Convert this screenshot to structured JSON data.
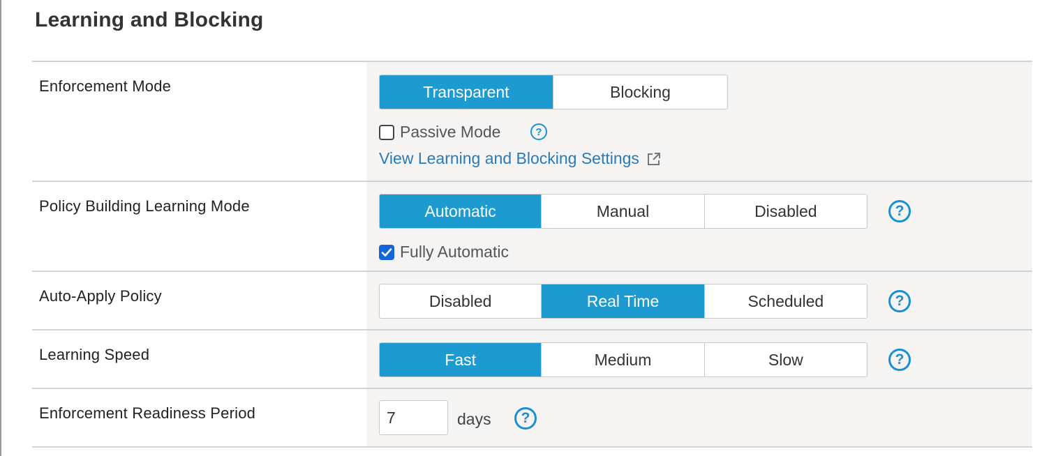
{
  "section": {
    "title": "Learning and Blocking"
  },
  "rows": {
    "enforcement_mode": {
      "label": "Enforcement Mode",
      "options": [
        "Transparent",
        "Blocking"
      ],
      "selected": "Transparent",
      "passive_mode_label": "Passive Mode",
      "passive_mode_checked": false,
      "settings_link": "View Learning and Blocking Settings"
    },
    "learning_mode": {
      "label": "Policy Building Learning Mode",
      "options": [
        "Automatic",
        "Manual",
        "Disabled"
      ],
      "selected": "Automatic",
      "fully_automatic_label": "Fully Automatic",
      "fully_automatic_checked": true
    },
    "auto_apply": {
      "label": "Auto-Apply Policy",
      "options": [
        "Disabled",
        "Real Time",
        "Scheduled"
      ],
      "selected": "Real Time"
    },
    "learning_speed": {
      "label": "Learning Speed",
      "options": [
        "Fast",
        "Medium",
        "Slow"
      ],
      "selected": "Fast"
    },
    "readiness": {
      "label": "Enforcement Readiness Period",
      "value": "7",
      "unit": "days"
    }
  },
  "help_glyph": "?",
  "colors": {
    "accent": "#1d9ad0",
    "help": "#1a8fd1",
    "link": "#2a7ab8",
    "checkbox_checked": "#1565d8"
  },
  "icons": [
    "help-circle-icon",
    "external-link-icon",
    "checkmark-icon"
  ]
}
